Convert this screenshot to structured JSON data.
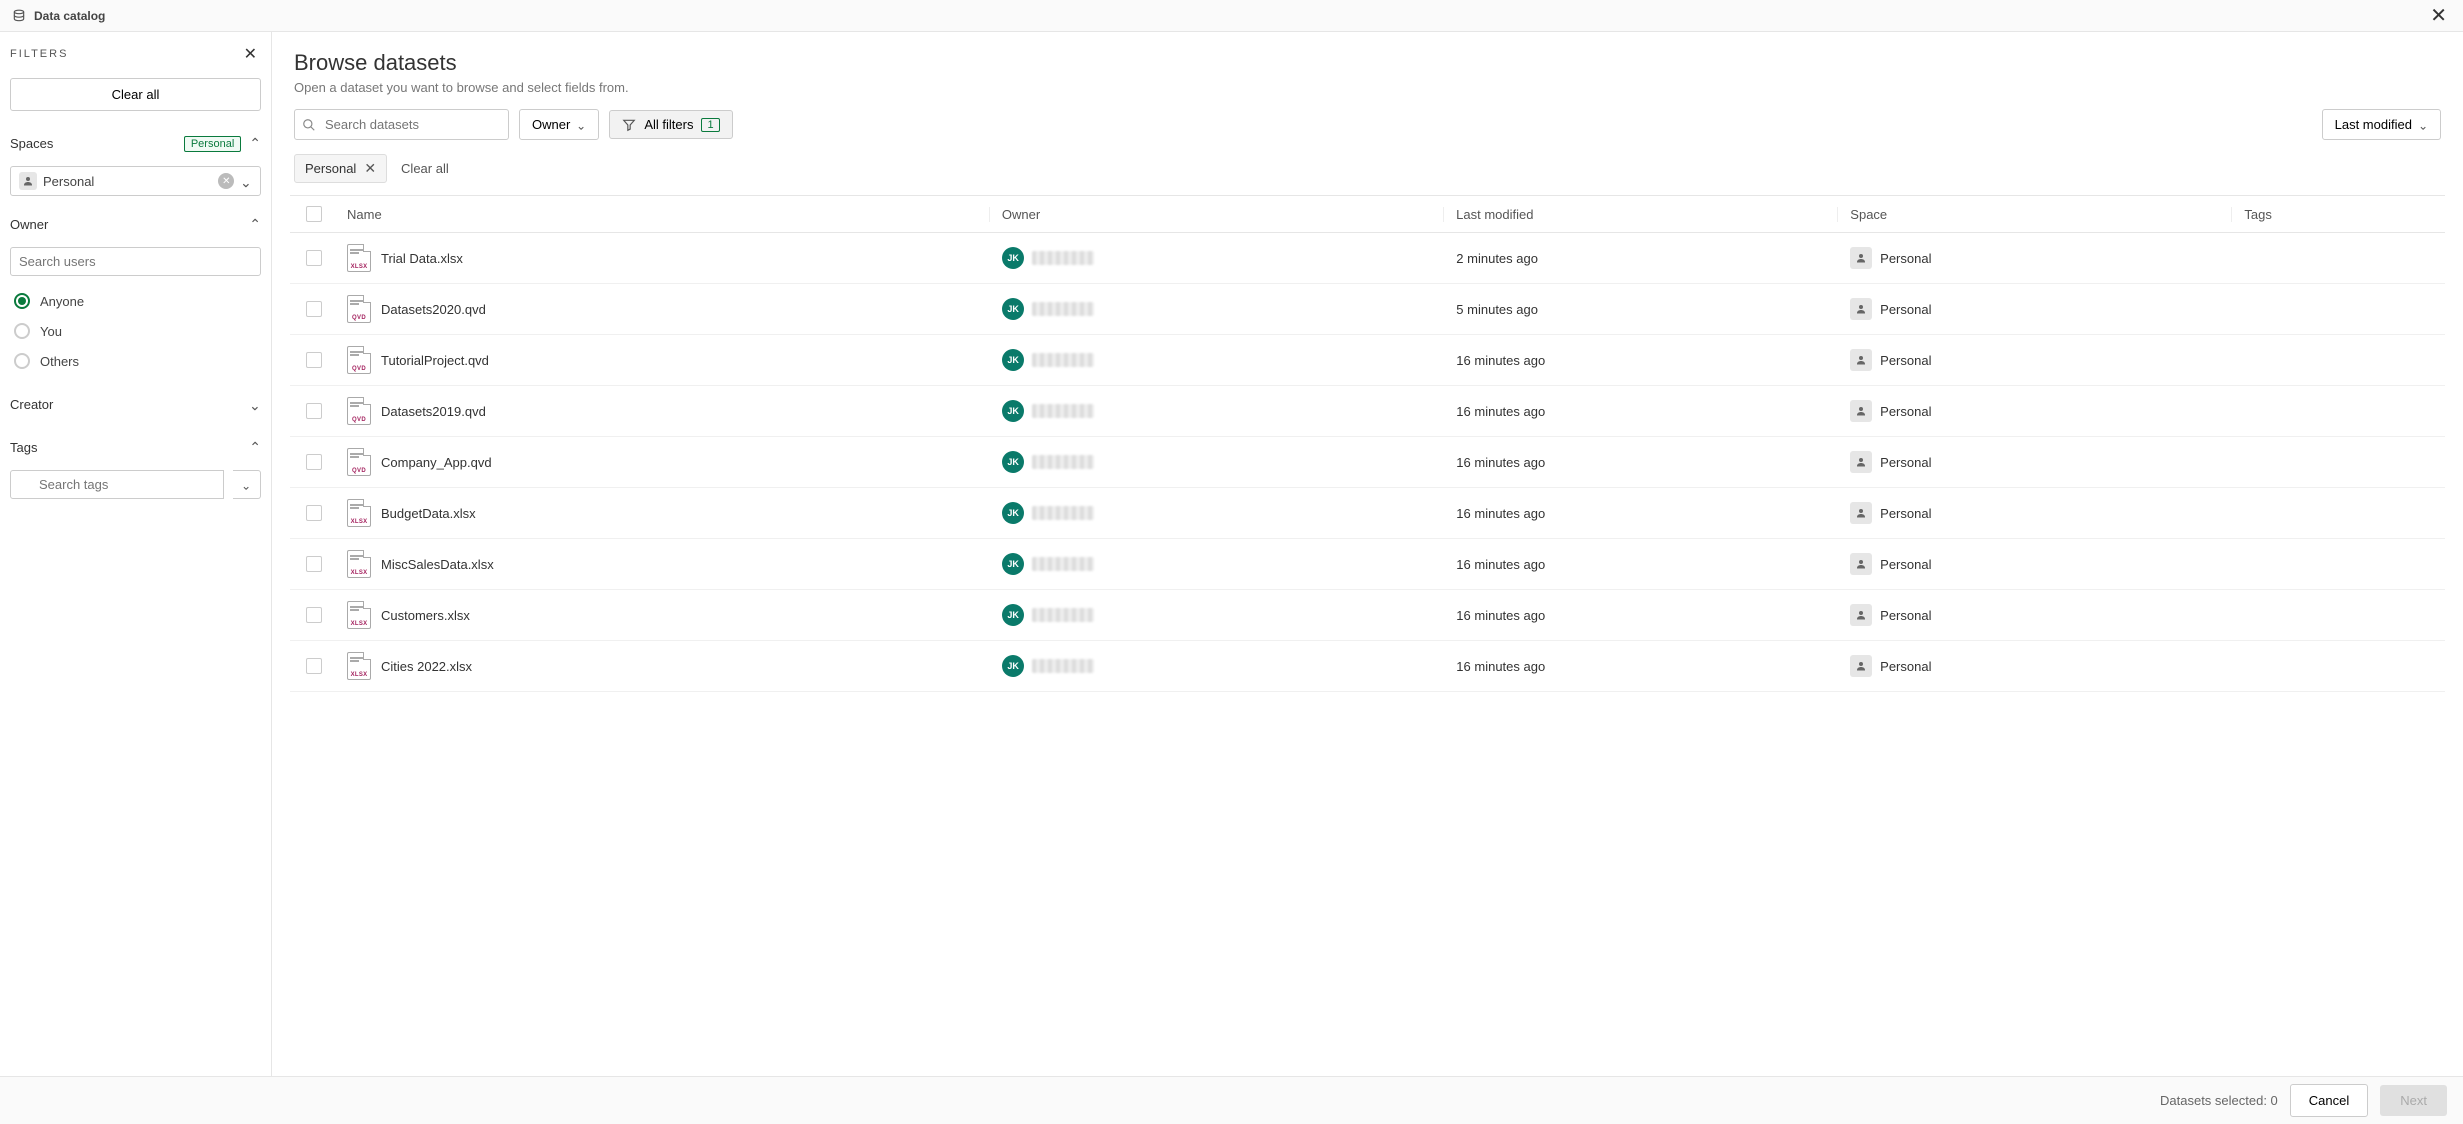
{
  "topBar": {
    "title": "Data catalog"
  },
  "sidebar": {
    "header": "FILTERS",
    "clearAll": "Clear all",
    "spaces": {
      "title": "Spaces",
      "chip": "Personal",
      "selected": "Personal"
    },
    "owner": {
      "title": "Owner",
      "searchPlaceholder": "Search users",
      "options": [
        "Anyone",
        "You",
        "Others"
      ],
      "selected": "Anyone"
    },
    "creator": {
      "title": "Creator"
    },
    "tags": {
      "title": "Tags",
      "searchPlaceholder": "Search tags"
    }
  },
  "content": {
    "title": "Browse datasets",
    "subtitle": "Open a dataset you want to browse and select fields from.",
    "searchPlaceholder": "Search datasets",
    "ownerBtn": "Owner",
    "allFilters": "All filters",
    "filterCount": "1",
    "sortBy": "Last modified",
    "activeFilter": "Personal",
    "clearAll": "Clear all",
    "columns": {
      "name": "Name",
      "owner": "Owner",
      "modified": "Last modified",
      "space": "Space",
      "tags": "Tags"
    },
    "rows": [
      {
        "name": "Trial Data.xlsx",
        "ext": "XLSX",
        "ownerInitials": "JK",
        "modified": "2 minutes ago",
        "space": "Personal"
      },
      {
        "name": "Datasets2020.qvd",
        "ext": "QVD",
        "ownerInitials": "JK",
        "modified": "5 minutes ago",
        "space": "Personal"
      },
      {
        "name": "TutorialProject.qvd",
        "ext": "QVD",
        "ownerInitials": "JK",
        "modified": "16 minutes ago",
        "space": "Personal"
      },
      {
        "name": "Datasets2019.qvd",
        "ext": "QVD",
        "ownerInitials": "JK",
        "modified": "16 minutes ago",
        "space": "Personal"
      },
      {
        "name": "Company_App.qvd",
        "ext": "QVD",
        "ownerInitials": "JK",
        "modified": "16 minutes ago",
        "space": "Personal"
      },
      {
        "name": "BudgetData.xlsx",
        "ext": "XLSX",
        "ownerInitials": "JK",
        "modified": "16 minutes ago",
        "space": "Personal"
      },
      {
        "name": "MiscSalesData.xlsx",
        "ext": "XLSX",
        "ownerInitials": "JK",
        "modified": "16 minutes ago",
        "space": "Personal"
      },
      {
        "name": "Customers.xlsx",
        "ext": "XLSX",
        "ownerInitials": "JK",
        "modified": "16 minutes ago",
        "space": "Personal"
      },
      {
        "name": "Cities 2022.xlsx",
        "ext": "XLSX",
        "ownerInitials": "JK",
        "modified": "16 minutes ago",
        "space": "Personal"
      }
    ]
  },
  "footer": {
    "selectedLabel": "Datasets selected: 0",
    "cancel": "Cancel",
    "next": "Next"
  }
}
